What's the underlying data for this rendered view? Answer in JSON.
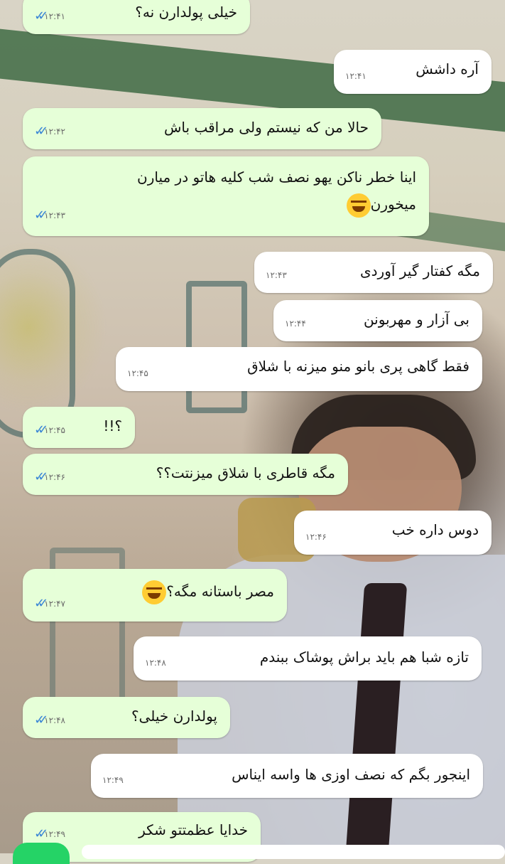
{
  "messages": [
    {
      "dir": "out",
      "text": "خیلی پولدارن نه؟",
      "time": "۱۲:۴۱"
    },
    {
      "dir": "in",
      "text": "آره داشش",
      "time": "۱۲:۴۱"
    },
    {
      "dir": "out",
      "text": "حالا من که نیستم ولی مراقب باش",
      "time": "۱۲:۴۲"
    },
    {
      "dir": "out",
      "text": "اینا خطر ناکن یهو نصف شب کلیه هاتو در میارن",
      "text2": "میخورن",
      "time": "۱۲:۴۳",
      "emoji": "face-with-tears-of-joy"
    },
    {
      "dir": "in",
      "text": "مگه کفتار گیر آوردی",
      "time": "۱۲:۴۳"
    },
    {
      "dir": "in",
      "text": "بی آزار و مهربونن",
      "time": "۱۲:۴۴"
    },
    {
      "dir": "in",
      "text": "فقط گاهی پری بانو منو میزنه با شلاق",
      "time": "۱۲:۴۵"
    },
    {
      "dir": "out",
      "text": "؟!!",
      "time": "۱۲:۴۵"
    },
    {
      "dir": "out",
      "text": "مگه قاطری با شلاق میزنتت؟؟",
      "time": "۱۲:۴۶"
    },
    {
      "dir": "in",
      "text": "دوس داره خب",
      "time": "۱۲:۴۶"
    },
    {
      "dir": "out",
      "text": "مصر باستانه مگه؟",
      "time": "۱۲:۴۷",
      "emoji": "face-with-tears-of-joy"
    },
    {
      "dir": "in",
      "text": "تازه شبا هم باید براش پوشاک ببندم",
      "time": "۱۲:۴۸"
    },
    {
      "dir": "out",
      "text": "پولدارن خیلی؟",
      "time": "۱۲:۴۸"
    },
    {
      "dir": "in",
      "text": "اینجور بگم که نصف اوزی ها واسه ایناس",
      "time": "۱۲:۴۹"
    },
    {
      "dir": "out",
      "text": "خدایا عظمتتو شکر",
      "time": "۱۲:۴۹"
    }
  ],
  "icons": {
    "read_ticks": "double-check-icon",
    "emoji": "face-with-tears-of-joy-icon"
  },
  "colors": {
    "outgoing": "#e6ffd8",
    "incoming": "#ffffff",
    "ticks": "#3a86d6"
  }
}
